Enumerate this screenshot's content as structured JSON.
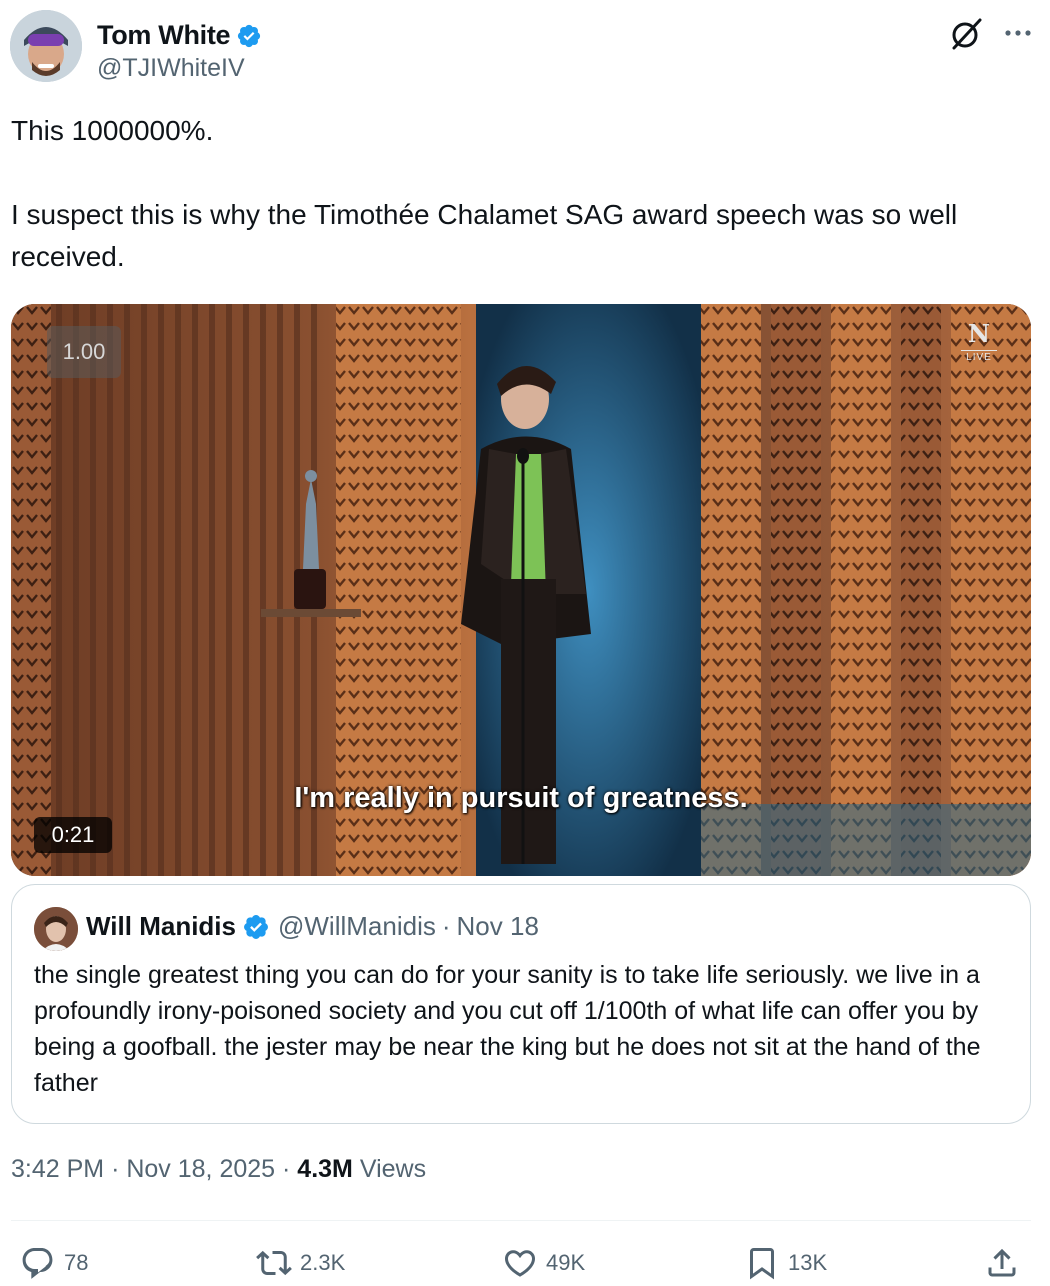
{
  "author": {
    "display_name": "Tom White",
    "handle": "@TJIWhiteIV",
    "verified": true
  },
  "tweet": {
    "text": "This 1000000%.\n\nI suspect this is why the Timothée Chalamet SAG award speech was so well received."
  },
  "video": {
    "playback_speed": "1.00",
    "duration": "0:21",
    "caption": "I'm really in pursuit of greatness.",
    "network_badge": "N",
    "live_label": "LIVE"
  },
  "quoted_tweet": {
    "display_name": "Will Manidis",
    "handle": "@WillManidis",
    "separator": "·",
    "date": "Nov 18",
    "verified": true,
    "text": "the single greatest thing you can do for your sanity is to take life seriously. we live in a profoundly irony-poisoned society and you cut off 1/100th of what life can offer you by being a goofball. the jester may be near the king but he does not sit at the hand of the father"
  },
  "meta": {
    "time": "3:42 PM",
    "date": "Nov 18, 2025",
    "separator": "·",
    "views_count": "4.3M",
    "views_label": "Views"
  },
  "actions": {
    "replies": "78",
    "reposts": "2.3K",
    "likes": "49K",
    "bookmarks": "13K"
  },
  "colors": {
    "verified_blue": "#1d9bf0",
    "secondary_text": "#536471",
    "primary_text": "#0f1419",
    "border": "#cfd9de"
  },
  "icons": [
    "verified-badge-icon",
    "grok-icon",
    "more-icon",
    "reply-icon",
    "repost-icon",
    "like-icon",
    "bookmark-icon",
    "share-icon"
  ]
}
